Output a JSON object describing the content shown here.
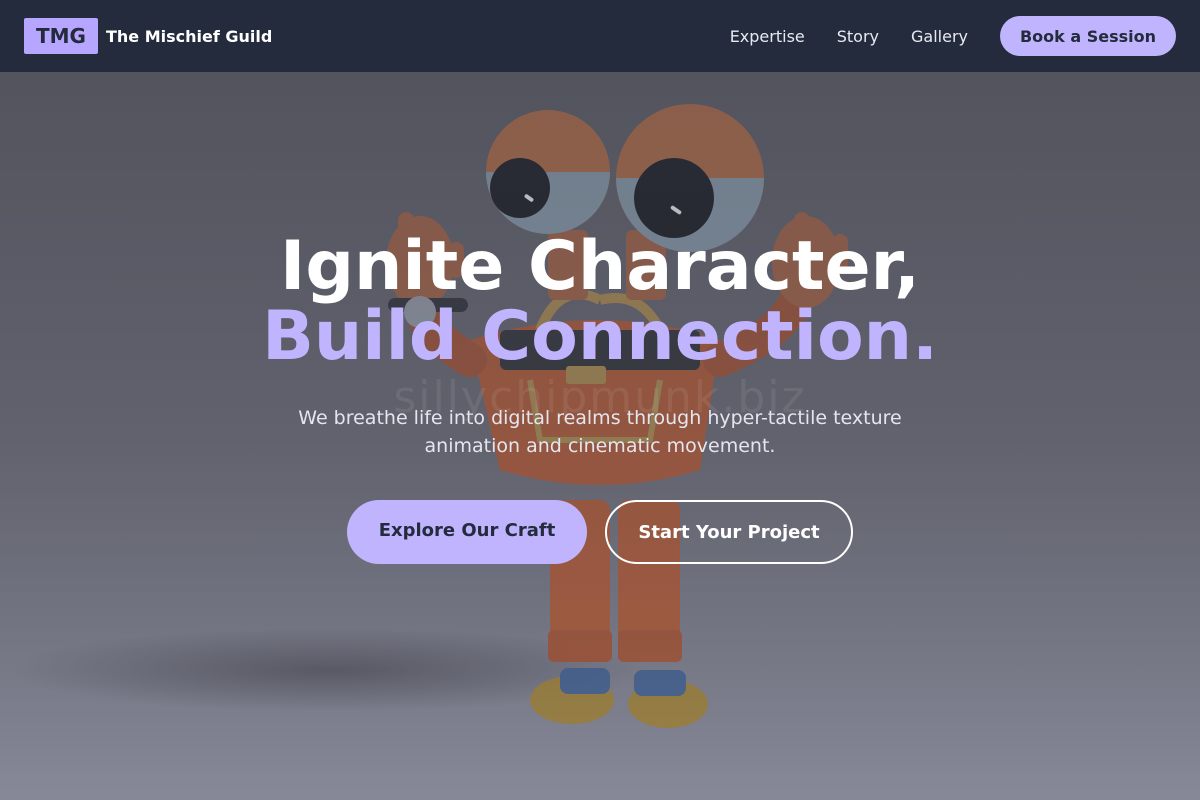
{
  "brand": {
    "badge": "TMG",
    "name": "The Mischief Guild"
  },
  "nav": {
    "links": [
      "Expertise",
      "Story",
      "Gallery"
    ],
    "cta": "Book a Session"
  },
  "hero": {
    "headline_line1": "Ignite Character,",
    "headline_line2": "Build Connection.",
    "subtitle": "We breathe life into digital realms through hyper-tactile texture animation and cinematic movement.",
    "primary_button": "Explore Our Craft",
    "secondary_button": "Start Your Project",
    "watermark": "sillychipmunk.biz"
  },
  "colors": {
    "nav_background": "#232b3c",
    "accent": "#c0b4ff",
    "text_light": "#ffffff"
  }
}
